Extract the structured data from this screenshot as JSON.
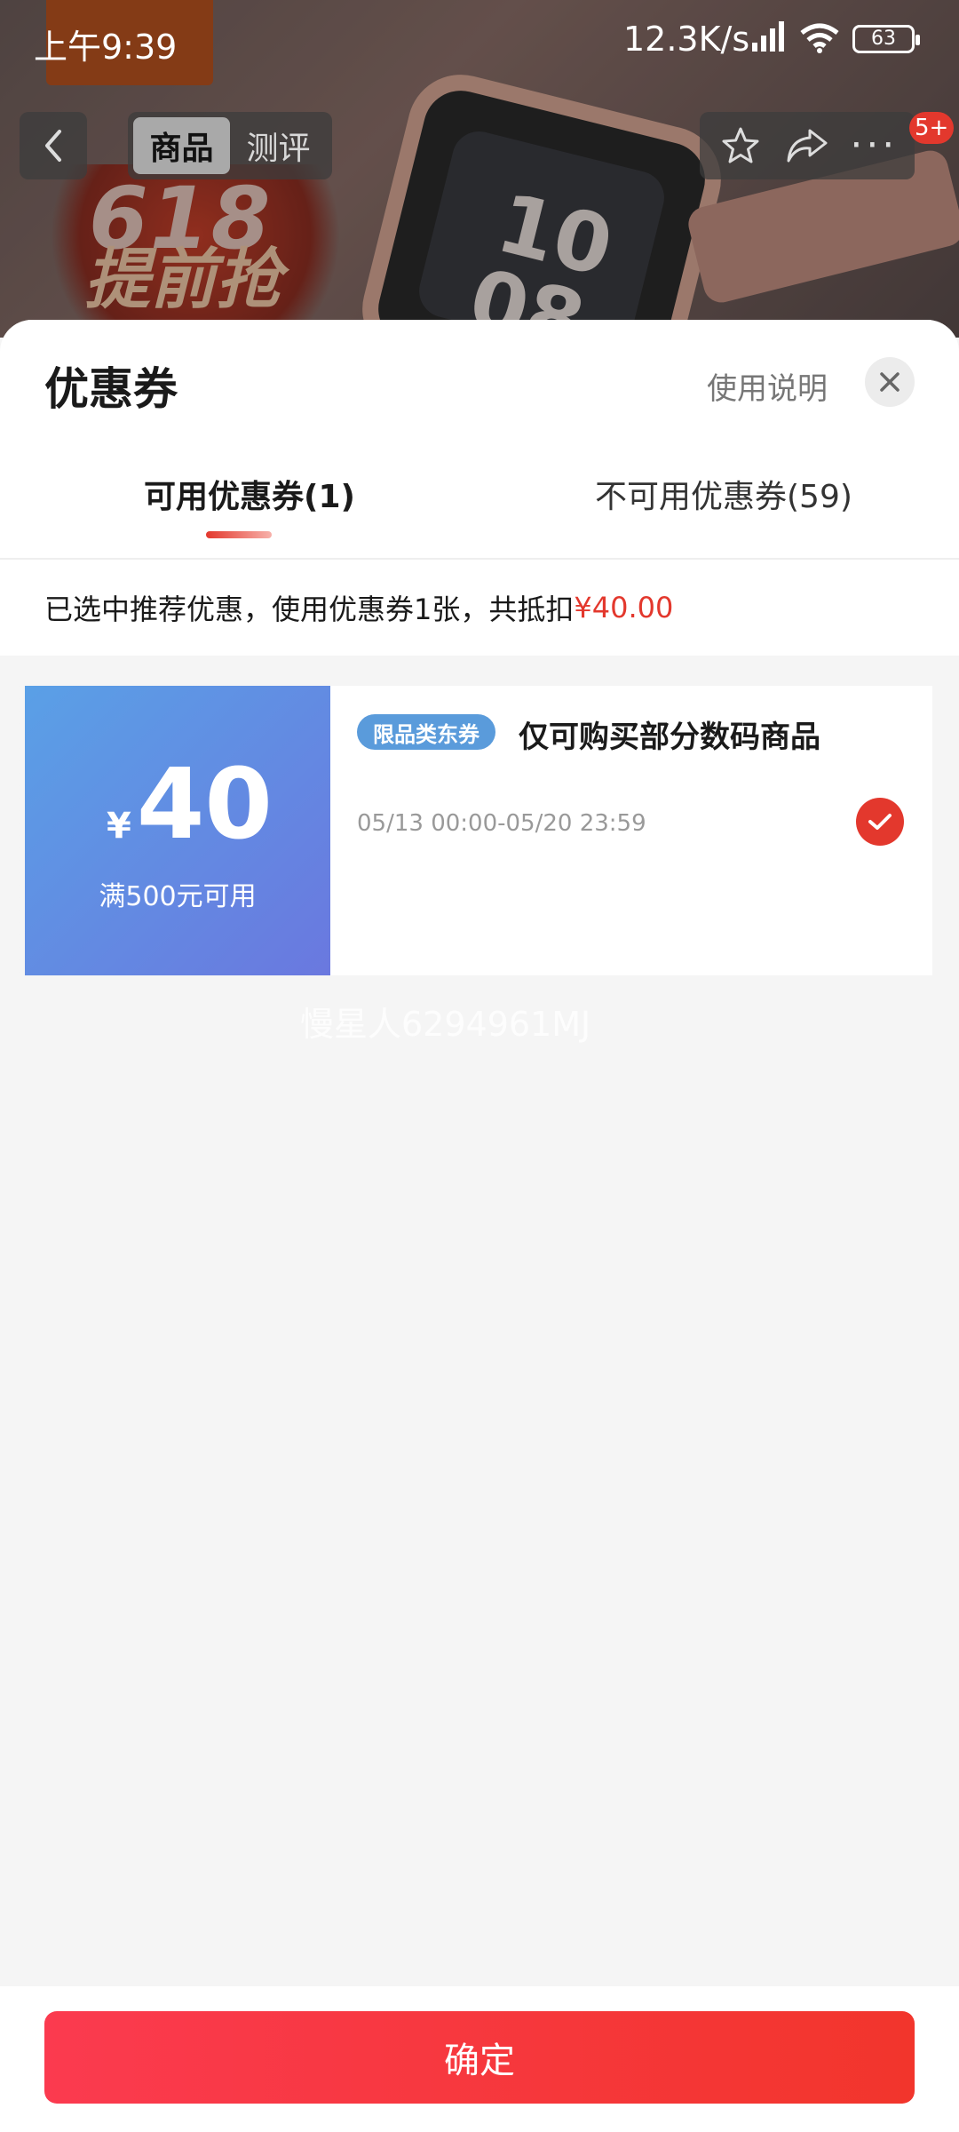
{
  "status_bar": {
    "time": "上午9:39",
    "network_speed": "12.3K/s",
    "battery": "63"
  },
  "background": {
    "promo_line_1": "618",
    "promo_line_2": "提前抢",
    "watch_time_1": "10",
    "watch_time_2": "08"
  },
  "nav": {
    "tabs": [
      {
        "label": "商品",
        "active": true
      },
      {
        "label": "测评",
        "active": false
      }
    ],
    "badge": "5+",
    "more_label": "···"
  },
  "sheet": {
    "title": "优惠券",
    "help_link": "使用说明",
    "tabs": {
      "available": "可用优惠券(1)",
      "unavailable": "不可用优惠券(59)"
    },
    "summary_prefix": "已选中推荐优惠，使用优惠券1张，共抵扣",
    "summary_amount": "¥40.00"
  },
  "coupon": {
    "currency": "¥",
    "amount": "40",
    "condition": "满500元可用",
    "tag": "限品类东券",
    "title": "仅可购买部分数码商品",
    "validity": "05/13 00:00-05/20 23:59",
    "selected": true
  },
  "watermark": "慢星人6294961MJ",
  "confirm_button": "确定",
  "colors": {
    "accent_red": "#e3382d",
    "coupon_blue_start": "#5aa0e6",
    "coupon_blue_end": "#6a78df"
  }
}
